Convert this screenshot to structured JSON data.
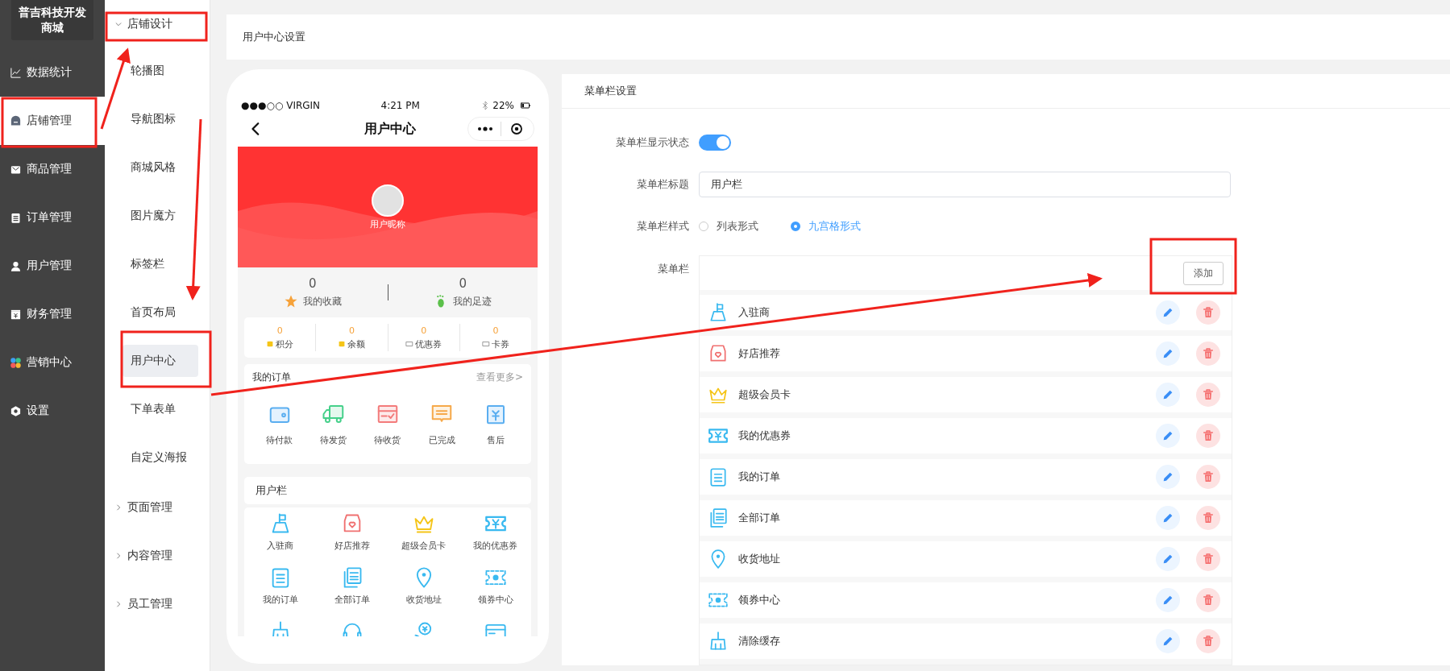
{
  "brand": "普吉科技开发商城",
  "sidebar": {
    "items": [
      {
        "label": "数据统计",
        "kind": "chart",
        "selected": false
      },
      {
        "label": "店铺管理",
        "kind": "store",
        "selected": true
      },
      {
        "label": "商品管理",
        "kind": "box",
        "selected": false
      },
      {
        "label": "订单管理",
        "kind": "clipboard",
        "selected": false
      },
      {
        "label": "用户管理",
        "kind": "user",
        "selected": false
      },
      {
        "label": "财务管理",
        "kind": "finance",
        "selected": false
      },
      {
        "label": "营销中心",
        "kind": "marketing",
        "selected": false
      },
      {
        "label": "设置",
        "kind": "gear",
        "selected": false
      }
    ]
  },
  "submenu": {
    "groups": [
      {
        "label": "店铺设计",
        "expanded": true,
        "children": [
          {
            "label": "轮播图",
            "selected": false
          },
          {
            "label": "导航图标",
            "selected": false
          },
          {
            "label": "商城风格",
            "selected": false
          },
          {
            "label": "图片魔方",
            "selected": false
          },
          {
            "label": "标签栏",
            "selected": false
          },
          {
            "label": "首页布局",
            "selected": false
          },
          {
            "label": "用户中心",
            "selected": true
          },
          {
            "label": "下单表单",
            "selected": false
          },
          {
            "label": "自定义海报",
            "selected": false
          }
        ]
      },
      {
        "label": "页面管理",
        "expanded": false
      },
      {
        "label": "内容管理",
        "expanded": false
      },
      {
        "label": "员工管理",
        "expanded": false
      }
    ]
  },
  "page_title": "用户中心设置",
  "phone": {
    "status_bar": {
      "carrier": "●●●○○ VIRGIN",
      "time": "4:21 PM",
      "battery": "22%"
    },
    "nav_title": "用户中心",
    "nickname": "用户昵称",
    "stats": [
      {
        "value": "0",
        "label": "我的收藏",
        "kind": "star"
      },
      {
        "value": "0",
        "label": "我的足迹",
        "kind": "foot"
      }
    ],
    "assets": [
      {
        "value": "0",
        "label": "积分",
        "kind": "coins"
      },
      {
        "value": "0",
        "label": "余额",
        "kind": "coins"
      },
      {
        "value": "0",
        "label": "优惠券",
        "kind": "ticket"
      },
      {
        "value": "0",
        "label": "卡券",
        "kind": "ticket"
      }
    ],
    "orders": {
      "title": "我的订单",
      "more": "查看更多>",
      "items": [
        {
          "label": "待付款",
          "kind": "wallet"
        },
        {
          "label": "待发货",
          "kind": "truck"
        },
        {
          "label": "待收货",
          "kind": "parcel"
        },
        {
          "label": "已完成",
          "kind": "message"
        },
        {
          "label": "售后",
          "kind": "refund"
        }
      ]
    },
    "menu_title": "用户栏",
    "menu_items": [
      {
        "label": "入驻商",
        "kind": "flag"
      },
      {
        "label": "好店推荐",
        "kind": "shop"
      },
      {
        "label": "超级会员卡",
        "kind": "crown"
      },
      {
        "label": "我的优惠券",
        "kind": "ticket"
      },
      {
        "label": "我的订单",
        "kind": "list"
      },
      {
        "label": "全部订单",
        "kind": "documents"
      },
      {
        "label": "收货地址",
        "kind": "pin"
      },
      {
        "label": "领券中心",
        "kind": "coupon"
      },
      {
        "kind": "broom"
      },
      {
        "kind": "headset"
      },
      {
        "kind": "coin"
      },
      {
        "kind": "card"
      }
    ]
  },
  "panel": {
    "title": "菜单栏设置",
    "show_label": "菜单栏显示状态",
    "show_on": true,
    "title_label": "菜单栏标题",
    "title_value": "用户栏",
    "style_label": "菜单栏样式",
    "styles": [
      {
        "label": "列表形式",
        "selected": false
      },
      {
        "label": "九宫格形式",
        "selected": true
      }
    ],
    "menu_label": "菜单栏",
    "add_button": "添加",
    "rows": [
      {
        "label": "入驻商",
        "kind": "flag"
      },
      {
        "label": "好店推荐",
        "kind": "shop"
      },
      {
        "label": "超级会员卡",
        "kind": "crown"
      },
      {
        "label": "我的优惠券",
        "kind": "ticket"
      },
      {
        "label": "我的订单",
        "kind": "list"
      },
      {
        "label": "全部订单",
        "kind": "documents"
      },
      {
        "label": "收货地址",
        "kind": "pin"
      },
      {
        "label": "领券中心",
        "kind": "coupon"
      },
      {
        "label": "清除缓存",
        "kind": "broom"
      }
    ]
  }
}
